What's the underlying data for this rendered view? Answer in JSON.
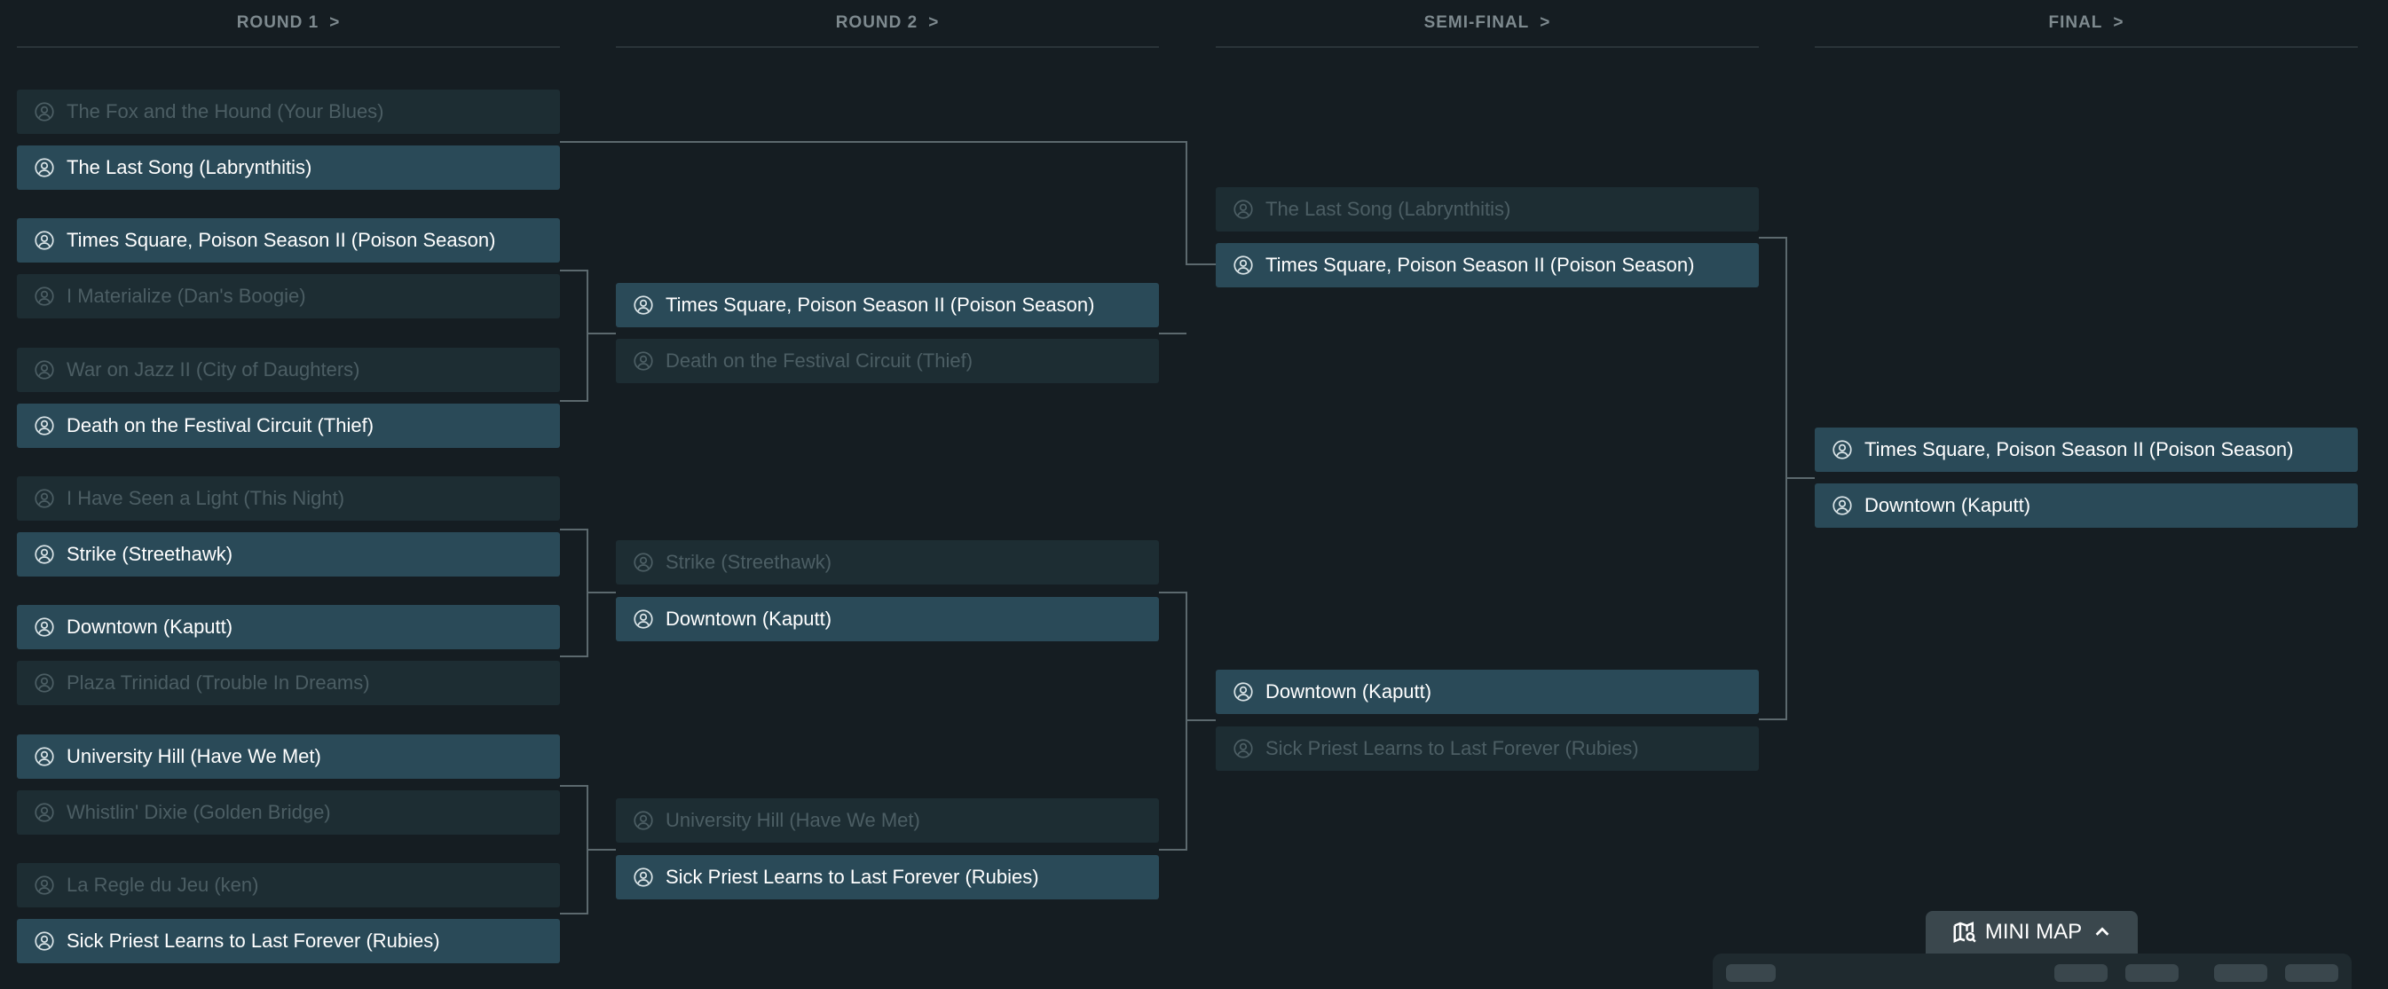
{
  "rounds": [
    {
      "label": "ROUND 1",
      "arrow": ">"
    },
    {
      "label": "ROUND 2",
      "arrow": ">"
    },
    {
      "label": "SEMI-FINAL",
      "arrow": ">"
    },
    {
      "label": "FINAL",
      "arrow": ">"
    }
  ],
  "round1": [
    {
      "name": "The Fox and the Hound (Your Blues)",
      "status": "lost"
    },
    {
      "name": "The Last Song (Labrynthitis)",
      "status": "won"
    },
    {
      "name": "Times Square, Poison Season II (Poison Season)",
      "status": "won"
    },
    {
      "name": "I Materialize (Dan's Boogie)",
      "status": "lost"
    },
    {
      "name": "War on Jazz II (City of Daughters)",
      "status": "lost"
    },
    {
      "name": "Death on the Festival Circuit (Thief)",
      "status": "won"
    },
    {
      "name": "I Have Seen a Light (This Night)",
      "status": "lost"
    },
    {
      "name": "Strike (Streethawk)",
      "status": "won"
    },
    {
      "name": "Downtown (Kaputt)",
      "status": "won"
    },
    {
      "name": "Plaza Trinidad (Trouble In Dreams)",
      "status": "lost"
    },
    {
      "name": "University Hill (Have We Met)",
      "status": "won"
    },
    {
      "name": "Whistlin' Dixie (Golden Bridge)",
      "status": "lost"
    },
    {
      "name": "La Regle du Jeu (ken)",
      "status": "lost"
    },
    {
      "name": "Sick Priest Learns to Last Forever (Rubies)",
      "status": "won"
    }
  ],
  "round2": [
    {
      "name": "Times Square, Poison Season II (Poison Season)",
      "status": "won"
    },
    {
      "name": "Death on the Festival Circuit (Thief)",
      "status": "lost"
    },
    {
      "name": "Strike (Streethawk)",
      "status": "lost"
    },
    {
      "name": "Downtown (Kaputt)",
      "status": "won"
    },
    {
      "name": "University Hill (Have We Met)",
      "status": "lost"
    },
    {
      "name": "Sick Priest Learns to Last Forever (Rubies)",
      "status": "won"
    }
  ],
  "semifinal": [
    {
      "name": "The Last Song (Labrynthitis)",
      "status": "lost"
    },
    {
      "name": "Times Square, Poison Season II (Poison Season)",
      "status": "won"
    },
    {
      "name": "Downtown (Kaputt)",
      "status": "won"
    },
    {
      "name": "Sick Priest Learns to Last Forever (Rubies)",
      "status": "lost"
    }
  ],
  "final": [
    {
      "name": "Times Square, Poison Season II (Poison Season)",
      "status": "won"
    },
    {
      "name": "Downtown (Kaputt)",
      "status": "won"
    }
  ],
  "minimap": {
    "label": "MINI MAP",
    "map_icon": "map-search-icon",
    "toggle_icon": "chevron-up-icon"
  },
  "team_icon": "user-circle-icon",
  "colors": {
    "background": "#151d22",
    "winner_bg": "#2a4a58",
    "loser_bg": "#1d2d33",
    "winner_text": "#ffffff",
    "loser_text": "#4c5e64",
    "connector": "#5c696e",
    "header_text": "#7e8a8f"
  }
}
